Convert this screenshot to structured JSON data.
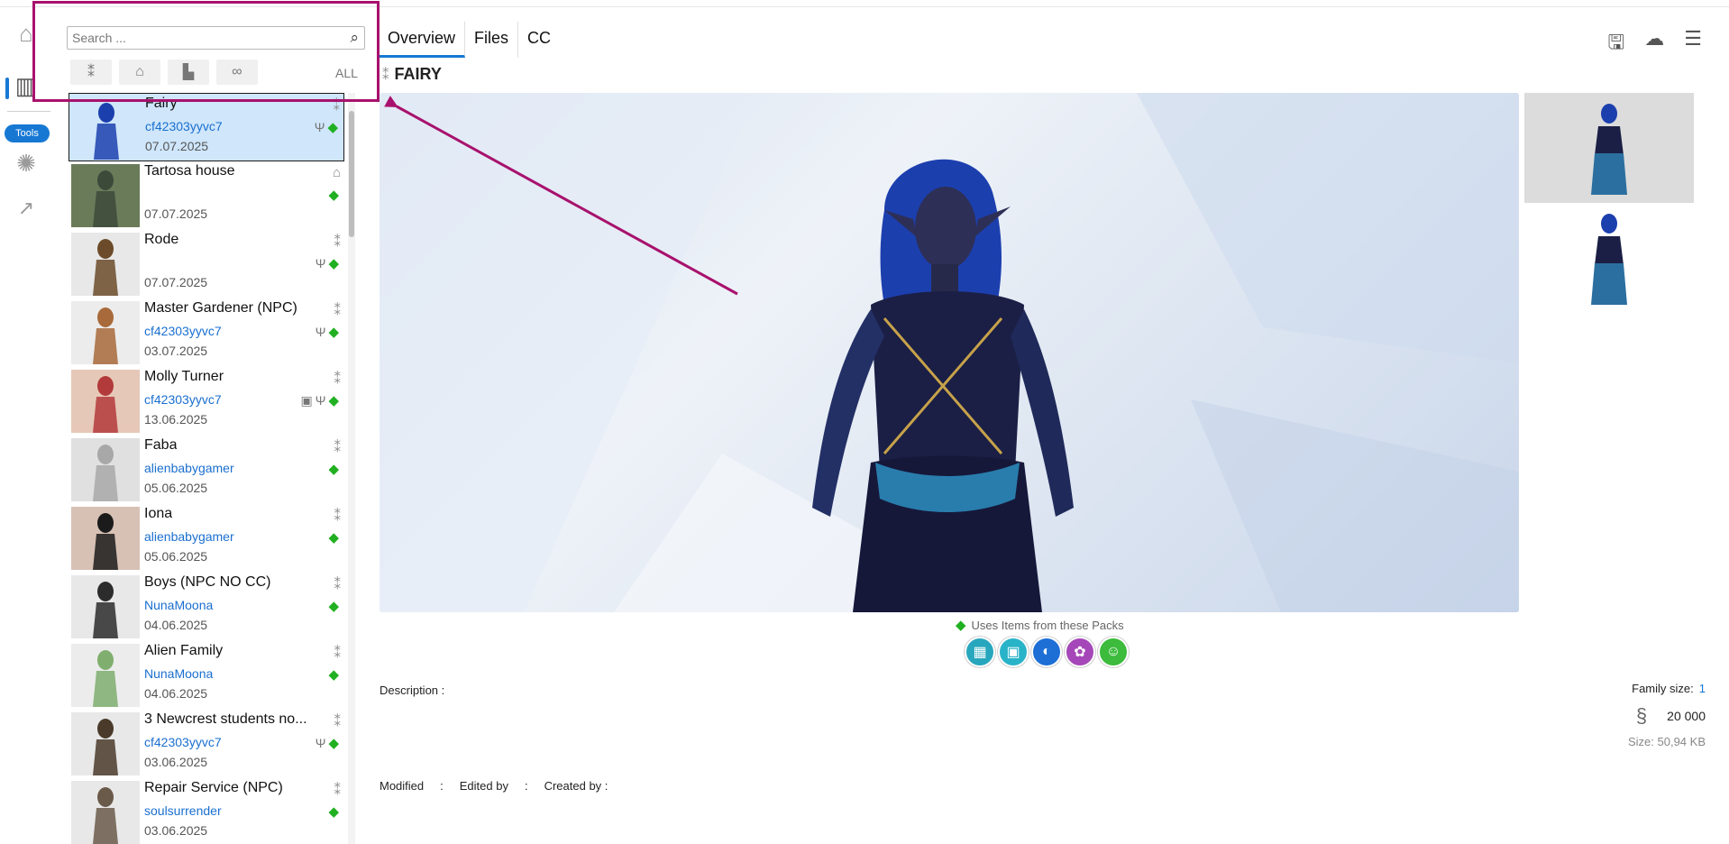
{
  "rail": {
    "items": [
      {
        "name": "home-icon",
        "glyph": "⌂"
      },
      {
        "name": "library-icon",
        "glyph": "▥"
      },
      {
        "name": "bug-icon",
        "glyph": "✺"
      },
      {
        "name": "chart-icon",
        "glyph": "↗"
      }
    ],
    "tools_label": "Tools"
  },
  "search": {
    "placeholder": "Search ..."
  },
  "filters": {
    "all_label": "ALL",
    "buttons": [
      "sims-filter-icon",
      "lots-filter-icon",
      "rooms-filter-icon",
      "infinity-filter-icon"
    ]
  },
  "list": {
    "items": [
      {
        "name": "Fairy",
        "author": "cf42303yyvc7",
        "date": "07.07.2025",
        "type": "sim",
        "tags": [
          "tool",
          "cc"
        ]
      },
      {
        "name": "Tartosa house",
        "author": "",
        "date": "07.07.2025",
        "type": "lot",
        "tags": [
          "cc"
        ]
      },
      {
        "name": "Rode",
        "author": "",
        "date": "07.07.2025",
        "type": "sim",
        "tags": [
          "tool",
          "cc"
        ]
      },
      {
        "name": "Master Gardener (NPC)",
        "author": "cf42303yyvc7",
        "date": "03.07.2025",
        "type": "sim",
        "tags": [
          "tool",
          "cc"
        ]
      },
      {
        "name": "Molly Turner",
        "author": "cf42303yyvc7",
        "date": "13.06.2025",
        "type": "sim",
        "tags": [
          "camera",
          "tool",
          "cc"
        ]
      },
      {
        "name": "Faba",
        "author": "alienbabygamer",
        "date": "05.06.2025",
        "type": "sim",
        "tags": [
          "cc"
        ]
      },
      {
        "name": "Iona",
        "author": "alienbabygamer",
        "date": "05.06.2025",
        "type": "sim",
        "tags": [
          "cc"
        ]
      },
      {
        "name": "Boys (NPC NO CC)",
        "author": "NunaMoona",
        "date": "04.06.2025",
        "type": "sim",
        "tags": [
          "cc"
        ]
      },
      {
        "name": "Alien Family",
        "author": "NunaMoona",
        "date": "04.06.2025",
        "type": "sim",
        "tags": [
          "cc"
        ]
      },
      {
        "name": "3 Newcrest students no...",
        "author": "cf42303yyvc7",
        "date": "03.06.2025",
        "type": "sim",
        "tags": [
          "tool",
          "cc"
        ]
      },
      {
        "name": "Repair Service (NPC)",
        "author": "soulsurrender",
        "date": "03.06.2025",
        "type": "sim",
        "tags": [
          "cc"
        ]
      }
    ]
  },
  "tabs": [
    "Overview",
    "Files",
    "CC"
  ],
  "header": {
    "title": "FAIRY"
  },
  "actions": [
    "save-icon",
    "cloud-download-icon",
    "menu-icon"
  ],
  "packs": {
    "label": "Uses Items from these Packs",
    "colors": [
      "#27a7bd",
      "#29b3c8",
      "#1d6fd6",
      "#a547b8",
      "#3cbb3c"
    ],
    "glyphs": [
      "▦",
      "▣",
      "◐",
      "✿",
      "☺"
    ]
  },
  "details": {
    "description_label": "Description :",
    "modified_label": "Modified",
    "edited_label": "Edited by",
    "created_label": "Created by :",
    "colon": ":",
    "family_size_label": "Family size:",
    "family_size_value": "1",
    "money": "20 000",
    "size_label": "Size:",
    "size_value": "50,94 KB"
  }
}
